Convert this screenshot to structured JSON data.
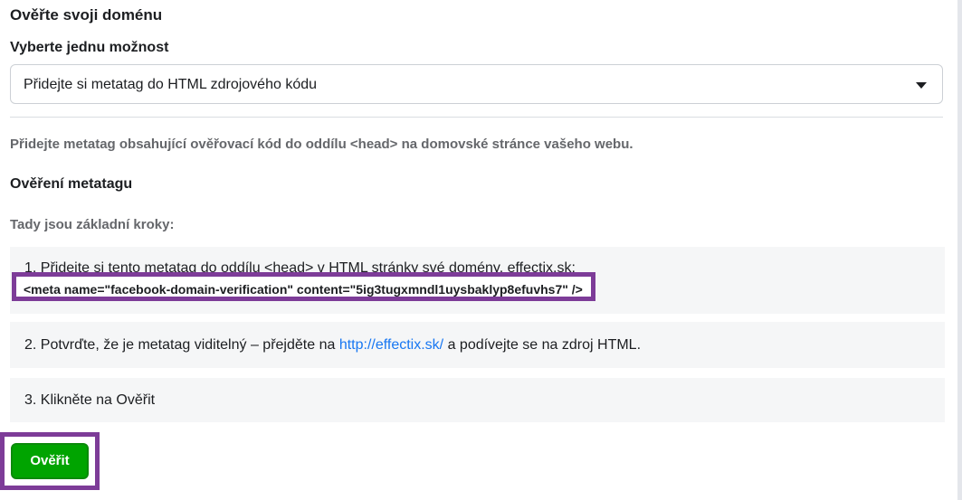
{
  "title": "Ověřte svoji doménu",
  "select": {
    "label": "Vyberte jednu možnost",
    "value": "Přidejte si metatag do HTML zdrojového kódu"
  },
  "instructions": "Přidejte metatag obsahující ověřovací kód do oddílu <head> na domovské stránce vašeho webu.",
  "section_title": "Ověření metatagu",
  "steps_heading": "Tady jsou základní kroky:",
  "steps": [
    {
      "text": "1. Přidejte si tento metatag do oddílu <head> v HTML stránky své domény, effectix.sk:",
      "code": "<meta name=\"facebook-domain-verification\" content=\"5ig3tugxmndl1uysbaklyp8efuvhs7\" />"
    },
    {
      "text_before": "2. Potvrďte, že je metatag viditelný – přejděte na ",
      "link": "http://effectix.sk/",
      "text_after": " a podívejte se na zdroj HTML."
    },
    {
      "text": "3. Klikněte na Ověřit"
    }
  ],
  "verify_button": "Ověřit",
  "colors": {
    "accent_highlight": "#7d3c98",
    "button_green": "#00a400",
    "link_blue": "#1877f2"
  }
}
